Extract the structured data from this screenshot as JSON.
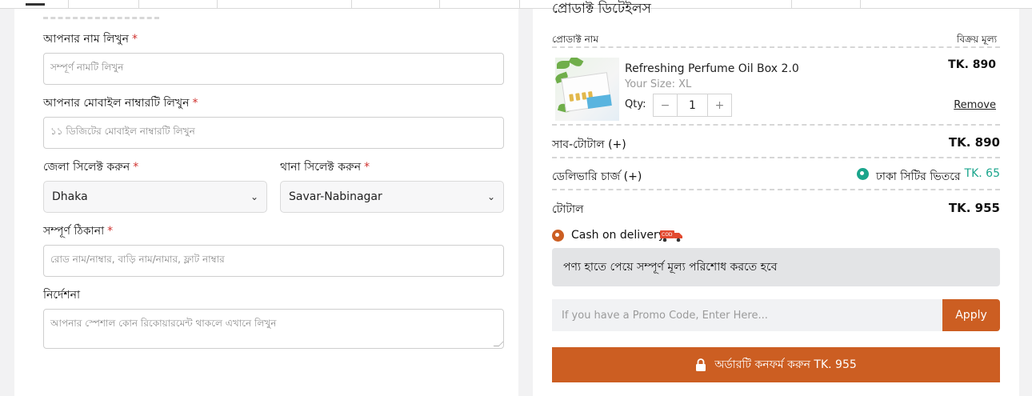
{
  "form": {
    "name_label": "আপনার নাম লিখুন",
    "name_placeholder": "সম্পূর্ণ নামটি লিখুন",
    "mobile_label": "আপনার মোবাইল নাম্বারটি লিখুন",
    "mobile_placeholder": "১১ ডিজিটের মোবাইল নাম্বারটি লিখুন",
    "district_label": "জেলা সিলেক্ট করুন",
    "district_value": "Dhaka",
    "thana_label": "থানা সিলেক্ট করুন",
    "thana_value": "Savar-Nabinagar",
    "address_label": "সম্পূর্ণ ঠিকানা",
    "address_placeholder": "রোড নাম/নাম্বার, বাড়ি নাম/নামার, ফ্লাট নাম্বার",
    "notes_label": "নির্দেশনা",
    "notes_placeholder": "আপনার স্পেশাল কোন রিকোয়ারমেন্ট থাকলে এখানে লিখুন",
    "required_mark": "*"
  },
  "order": {
    "title": "প্রোডাক্ট ডিটেইলস",
    "col_product": "প্রোডাক্ট নাম",
    "col_price": "বিক্রয় মূল্য",
    "item": {
      "name": "Refreshing Perfume Oil Box 2.0",
      "size": "Your Size: XL",
      "qty_label": "Qty:",
      "qty": "1",
      "minus": "−",
      "plus": "+",
      "price": "TK. 890",
      "remove": "Remove"
    },
    "subtotal_label": "সাব-টোটাল (+)",
    "subtotal_value": "TK. 890",
    "delivery_label": "ডেলিভারি চার্জ (+)",
    "delivery_option": "ঢাকা সিটির ভিতরে",
    "delivery_value": "TK. 65",
    "total_label": "টোটাল",
    "total_value": "TK. 955",
    "payment_option": "Cash on delivery",
    "cod_badge": "COD",
    "payment_note": "পণ্য হাতে পেয়ে সম্পূর্ণ মূল্য পরিশোধ করতে হবে",
    "promo_placeholder": "If you have a Promo Code, Enter Here...",
    "apply_label": "Apply",
    "confirm_label": "অর্ডারটি কনফর্ম করুন TK. 955"
  },
  "colors": {
    "accent": "#cc5e22",
    "teal": "#1aa58c",
    "required": "#d0322f"
  }
}
